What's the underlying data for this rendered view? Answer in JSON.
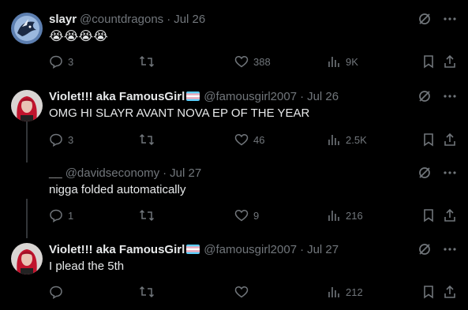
{
  "tweets": [
    {
      "name": "slayr",
      "handle": "@countdragons",
      "date": "Jul 26",
      "text": "😭😭😭😭",
      "replies": "3",
      "retweets": "",
      "likes": "388",
      "views": "9K",
      "avatar_icon": "dragon-avatar",
      "has_flag": false
    },
    {
      "name": "Violet!!! aka FamousGirl",
      "handle": "@famousgirl2007",
      "date": "Jul 26",
      "text": "OMG HI SLAYR AVANT NOVA EP OF THE YEAR",
      "replies": "3",
      "retweets": "",
      "likes": "46",
      "views": "2.5K",
      "avatar_icon": "red-hair-avatar",
      "has_flag": true
    },
    {
      "name": "__",
      "handle": "@davidseconomy",
      "date": "Jul 27",
      "text": "nigga folded automatically",
      "replies": "1",
      "retweets": "",
      "likes": "9",
      "views": "216",
      "avatar_icon": "",
      "has_flag": false
    },
    {
      "name": "Violet!!! aka FamousGirl",
      "handle": "@famousgirl2007",
      "date": "Jul 27",
      "text": "I plead the 5th",
      "replies": "",
      "retweets": "",
      "likes": "",
      "views": "212",
      "avatar_icon": "red-hair-avatar",
      "has_flag": true
    }
  ],
  "separator": "·",
  "colors": {
    "background": "#000000",
    "text": "#e7e9ea",
    "muted": "#71767b",
    "thread_line": "#333639"
  }
}
